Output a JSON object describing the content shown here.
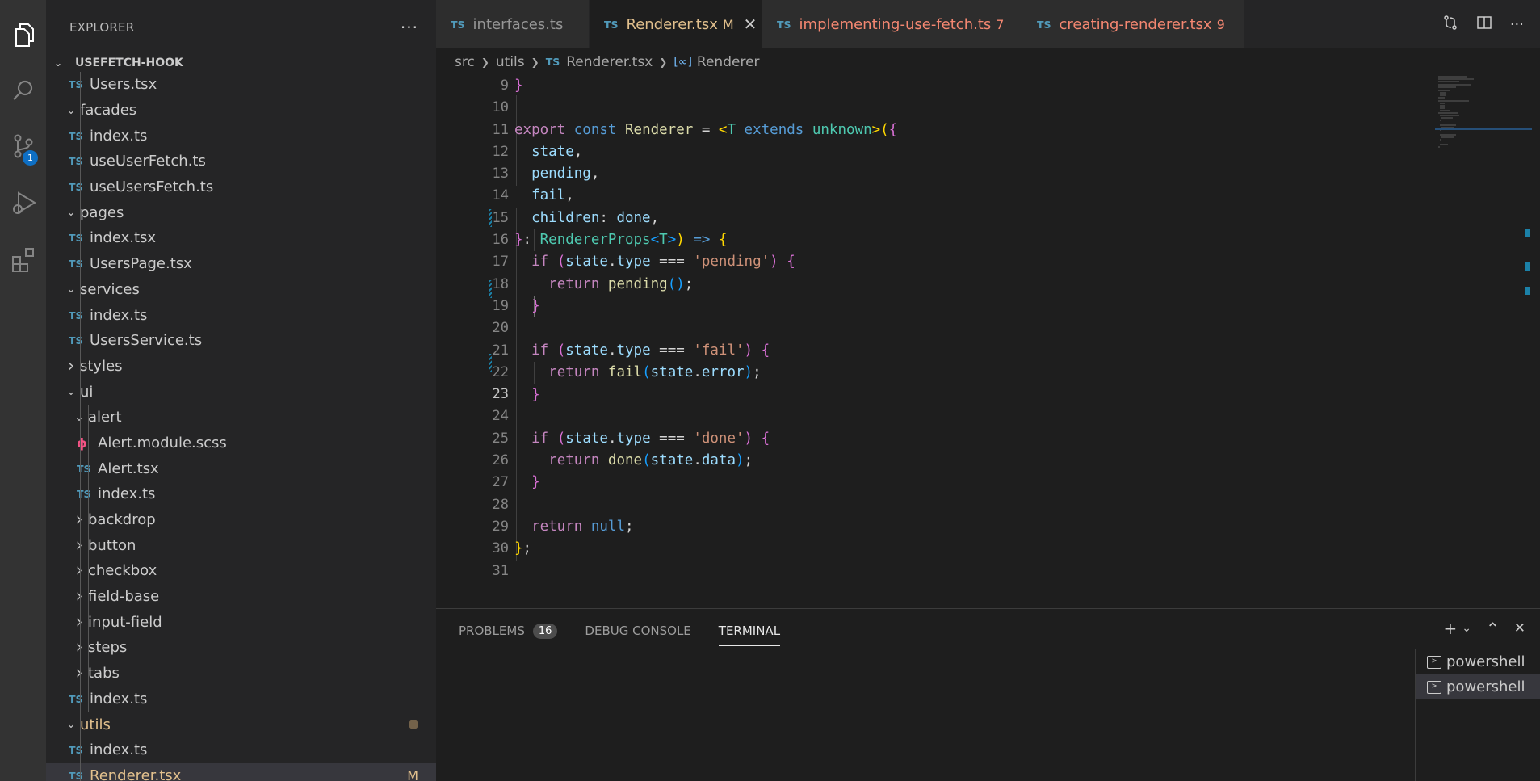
{
  "sidebar": {
    "title": "EXPLORER",
    "more": "···",
    "section": "USEFETCH-HOOK",
    "tree": [
      {
        "indent": 1,
        "kind": "file",
        "label": "Users.tsx"
      },
      {
        "indent": 1,
        "kind": "folder",
        "open": true,
        "label": "facades"
      },
      {
        "indent": 1,
        "kind": "file",
        "label": "index.ts"
      },
      {
        "indent": 1,
        "kind": "file",
        "label": "useUserFetch.ts"
      },
      {
        "indent": 1,
        "kind": "file",
        "label": "useUsersFetch.ts"
      },
      {
        "indent": 1,
        "kind": "folder",
        "open": true,
        "label": "pages"
      },
      {
        "indent": 1,
        "kind": "file",
        "label": "index.tsx"
      },
      {
        "indent": 1,
        "kind": "file",
        "label": "UsersPage.tsx"
      },
      {
        "indent": 1,
        "kind": "folder",
        "open": true,
        "label": "services"
      },
      {
        "indent": 1,
        "kind": "file",
        "label": "index.ts"
      },
      {
        "indent": 1,
        "kind": "file",
        "label": "UsersService.ts"
      },
      {
        "indent": 1,
        "kind": "folder",
        "open": false,
        "label": "styles"
      },
      {
        "indent": 1,
        "kind": "folder",
        "open": true,
        "label": "ui"
      },
      {
        "indent": 2,
        "kind": "folder",
        "open": true,
        "label": "alert"
      },
      {
        "indent": 2,
        "kind": "scss",
        "label": "Alert.module.scss"
      },
      {
        "indent": 2,
        "kind": "file",
        "label": "Alert.tsx"
      },
      {
        "indent": 2,
        "kind": "file",
        "label": "index.ts"
      },
      {
        "indent": 2,
        "kind": "folder",
        "open": false,
        "label": "backdrop"
      },
      {
        "indent": 2,
        "kind": "folder",
        "open": false,
        "label": "button"
      },
      {
        "indent": 2,
        "kind": "folder",
        "open": false,
        "label": "checkbox"
      },
      {
        "indent": 2,
        "kind": "folder",
        "open": false,
        "label": "field-base"
      },
      {
        "indent": 2,
        "kind": "folder",
        "open": false,
        "label": "input-field"
      },
      {
        "indent": 2,
        "kind": "folder",
        "open": false,
        "label": "steps"
      },
      {
        "indent": 2,
        "kind": "folder",
        "open": false,
        "label": "tabs"
      },
      {
        "indent": 1,
        "kind": "file",
        "label": "index.ts"
      },
      {
        "indent": 1,
        "kind": "folder",
        "open": true,
        "label": "utils",
        "modified_dot": true,
        "modified": true
      },
      {
        "indent": 1,
        "kind": "file",
        "label": "index.ts"
      },
      {
        "indent": 1,
        "kind": "file",
        "label": "Renderer.tsx",
        "active": true,
        "modified": true,
        "badge": "M"
      }
    ]
  },
  "activity": {
    "scm_badge": "1"
  },
  "tabs": [
    {
      "label": "interfaces.ts",
      "state": "inactive"
    },
    {
      "label": "Renderer.tsx",
      "state": "active",
      "badge": "M",
      "close": "✕"
    },
    {
      "label": "implementing-use-fetch.ts",
      "state": "error",
      "count": "7"
    },
    {
      "label": "creating-renderer.tsx",
      "state": "error",
      "count": "9"
    }
  ],
  "ts_icon_text": "TS",
  "breadcrumb": {
    "parts": [
      "src",
      "utils",
      "Renderer.tsx",
      "Renderer"
    ]
  },
  "editor": {
    "current_line": 23,
    "line_numbers": [
      "9",
      "10",
      "11",
      "12",
      "13",
      "14",
      "15",
      "16",
      "17",
      "18",
      "19",
      "20",
      "21",
      "22",
      "23",
      "24",
      "25",
      "26",
      "27",
      "28",
      "29",
      "30",
      "31"
    ],
    "lines": [
      [
        [
          "br2",
          "}"
        ]
      ],
      [],
      [
        [
          "ctl",
          "export"
        ],
        [
          "plain",
          " "
        ],
        [
          "kw",
          "const"
        ],
        [
          "plain",
          " "
        ],
        [
          "fn",
          "Renderer"
        ],
        [
          "plain",
          " = "
        ],
        [
          "br1",
          "<"
        ],
        [
          "ty",
          "T"
        ],
        [
          "plain",
          " "
        ],
        [
          "kw",
          "extends"
        ],
        [
          "plain",
          " "
        ],
        [
          "ty",
          "unknown"
        ],
        [
          "br1",
          ">("
        ],
        [
          "br2",
          "{"
        ]
      ],
      [
        [
          "plain",
          "  "
        ],
        [
          "var",
          "state"
        ],
        [
          "plain",
          ","
        ]
      ],
      [
        [
          "plain",
          "  "
        ],
        [
          "var",
          "pending"
        ],
        [
          "plain",
          ","
        ]
      ],
      [
        [
          "plain",
          "  "
        ],
        [
          "var",
          "fail"
        ],
        [
          "plain",
          ","
        ]
      ],
      [
        [
          "plain",
          "  "
        ],
        [
          "var",
          "children"
        ],
        [
          "plain",
          ": "
        ],
        [
          "var",
          "done"
        ],
        [
          "plain",
          ","
        ]
      ],
      [
        [
          "br2",
          "}"
        ],
        [
          "plain",
          ": "
        ],
        [
          "ty",
          "RendererProps"
        ],
        [
          "br3",
          "<"
        ],
        [
          "ty",
          "T"
        ],
        [
          "br3",
          ">"
        ],
        [
          "br1",
          ")"
        ],
        [
          "plain",
          " "
        ],
        [
          "kw",
          "=>"
        ],
        [
          "plain",
          " "
        ],
        [
          "br1",
          "{"
        ]
      ],
      [
        [
          "plain",
          "  "
        ],
        [
          "ctl",
          "if"
        ],
        [
          "plain",
          " "
        ],
        [
          "br2",
          "("
        ],
        [
          "var",
          "state"
        ],
        [
          "plain",
          "."
        ],
        [
          "var",
          "type"
        ],
        [
          "plain",
          " === "
        ],
        [
          "str",
          "'pending'"
        ],
        [
          "br2",
          ")"
        ],
        [
          "plain",
          " "
        ],
        [
          "br2",
          "{"
        ]
      ],
      [
        [
          "plain",
          "    "
        ],
        [
          "ctl",
          "return"
        ],
        [
          "plain",
          " "
        ],
        [
          "fn",
          "pending"
        ],
        [
          "br3",
          "()"
        ],
        [
          "plain",
          ";"
        ]
      ],
      [
        [
          "plain",
          "  "
        ],
        [
          "br2",
          "}"
        ]
      ],
      [],
      [
        [
          "plain",
          "  "
        ],
        [
          "ctl",
          "if"
        ],
        [
          "plain",
          " "
        ],
        [
          "br2",
          "("
        ],
        [
          "var",
          "state"
        ],
        [
          "plain",
          "."
        ],
        [
          "var",
          "type"
        ],
        [
          "plain",
          " === "
        ],
        [
          "str",
          "'fail'"
        ],
        [
          "br2",
          ")"
        ],
        [
          "plain",
          " "
        ],
        [
          "br2",
          "{"
        ]
      ],
      [
        [
          "plain",
          "    "
        ],
        [
          "ctl",
          "return"
        ],
        [
          "plain",
          " "
        ],
        [
          "fn",
          "fail"
        ],
        [
          "br3",
          "("
        ],
        [
          "var",
          "state"
        ],
        [
          "plain",
          "."
        ],
        [
          "var",
          "error"
        ],
        [
          "br3",
          ")"
        ],
        [
          "plain",
          ";"
        ]
      ],
      [
        [
          "plain",
          "  "
        ],
        [
          "br2",
          "}"
        ]
      ],
      [],
      [
        [
          "plain",
          "  "
        ],
        [
          "ctl",
          "if"
        ],
        [
          "plain",
          " "
        ],
        [
          "br2",
          "("
        ],
        [
          "var",
          "state"
        ],
        [
          "plain",
          "."
        ],
        [
          "var",
          "type"
        ],
        [
          "plain",
          " === "
        ],
        [
          "str",
          "'done'"
        ],
        [
          "br2",
          ")"
        ],
        [
          "plain",
          " "
        ],
        [
          "br2",
          "{"
        ]
      ],
      [
        [
          "plain",
          "    "
        ],
        [
          "ctl",
          "return"
        ],
        [
          "plain",
          " "
        ],
        [
          "fn",
          "done"
        ],
        [
          "br3",
          "("
        ],
        [
          "var",
          "state"
        ],
        [
          "plain",
          "."
        ],
        [
          "var",
          "data"
        ],
        [
          "br3",
          ")"
        ],
        [
          "plain",
          ";"
        ]
      ],
      [
        [
          "plain",
          "  "
        ],
        [
          "br2",
          "}"
        ]
      ],
      [],
      [
        [
          "plain",
          "  "
        ],
        [
          "ctl",
          "return"
        ],
        [
          "plain",
          " "
        ],
        [
          "kw",
          "null"
        ],
        [
          "plain",
          ";"
        ]
      ],
      [
        [
          "br1",
          "}"
        ],
        [
          "plain",
          ";"
        ]
      ],
      []
    ]
  },
  "panel": {
    "tabs": [
      {
        "label": "PROBLEMS",
        "badge": "16"
      },
      {
        "label": "DEBUG CONSOLE"
      },
      {
        "label": "TERMINAL",
        "active": true
      }
    ],
    "actions": [
      "+",
      "⌄",
      "⌃",
      "✕"
    ],
    "terminals": [
      {
        "label": "powershell",
        "selected": false
      },
      {
        "label": "powershell",
        "selected": true
      }
    ]
  }
}
